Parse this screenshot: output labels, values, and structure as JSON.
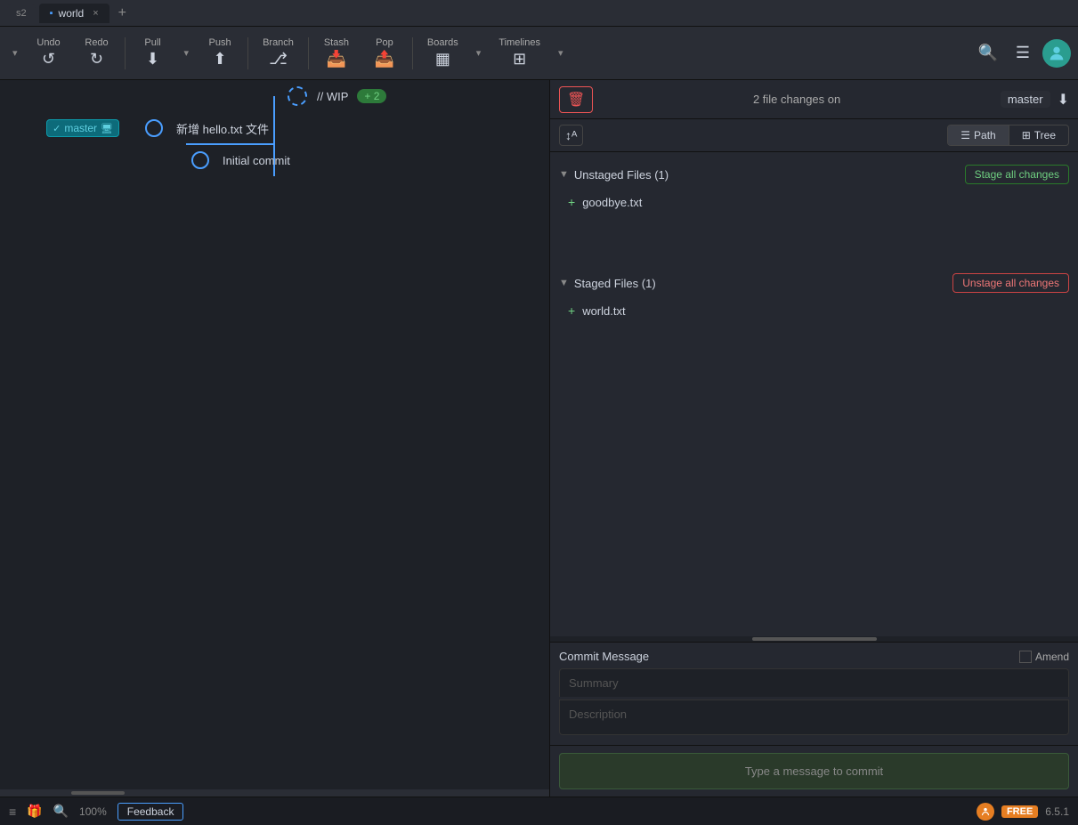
{
  "titlebar": {
    "prev_tab": "s2",
    "current_tab": "world",
    "close_label": "×",
    "add_tab": "+"
  },
  "toolbar": {
    "undo_label": "Undo",
    "redo_label": "Redo",
    "pull_label": "Pull",
    "push_label": "Push",
    "branch_label": "Branch",
    "stash_label": "Stash",
    "pop_label": "Pop",
    "boards_label": "Boards",
    "timelines_label": "Timelines"
  },
  "graph": {
    "wip_label": "// WIP",
    "wip_badge": "+ 2",
    "commit1_msg": "新增 hello.txt 文件",
    "commit2_msg": "Initial commit",
    "branch_name": "master"
  },
  "right_panel": {
    "file_changes_text": "2 file changes on",
    "branch_name": "master",
    "path_label": "Path",
    "tree_label": "Tree",
    "unstaged_title": "Unstaged Files (1)",
    "stage_all_label": "Stage all changes",
    "unstaged_file": "goodbye.txt",
    "staged_title": "Staged Files (1)",
    "unstage_all_label": "Unstage all changes",
    "staged_file": "world.txt",
    "commit_message_label": "Commit Message",
    "amend_label": "Amend",
    "summary_placeholder": "Summary",
    "desc_placeholder": "Description",
    "commit_btn_label": "Type a message to commit"
  },
  "statusbar": {
    "zoom_label": "100%",
    "feedback_label": "Feedback",
    "free_label": "FREE",
    "version_label": "6.5.1"
  }
}
